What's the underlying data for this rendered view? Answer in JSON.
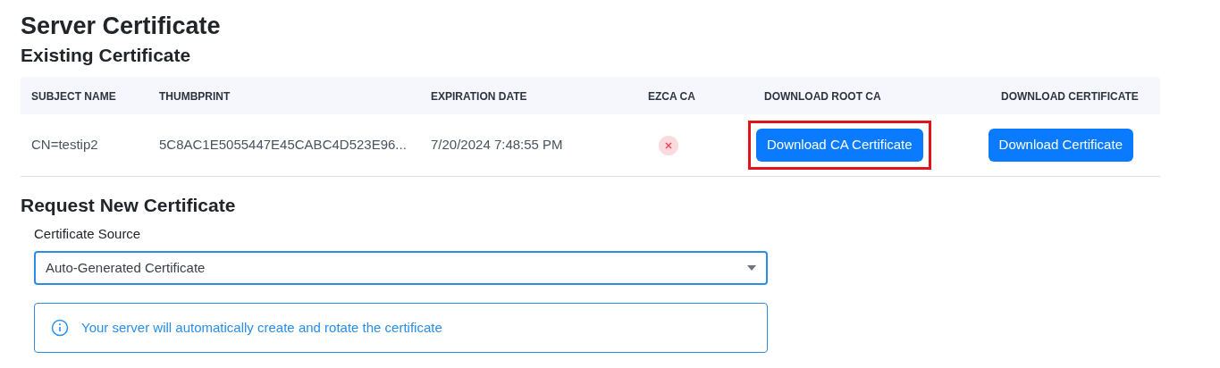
{
  "title": "Server Certificate",
  "existing": {
    "heading": "Existing Certificate",
    "columns": [
      "SUBJECT NAME",
      "THUMBPRINT",
      "EXPIRATION DATE",
      "EZCA CA",
      "DOWNLOAD ROOT CA",
      "DOWNLOAD CERTIFICATE"
    ],
    "rows": [
      {
        "subject": "CN=testip2",
        "thumbprint": "5C8AC1E5055447E45CABC4D523E96...",
        "expiration": "7/20/2024 7:48:55 PM",
        "ezca_ca": false,
        "root_button": {
          "label": "Download CA Certificate",
          "highlighted": true
        },
        "cert_button": {
          "label": "Download Certificate",
          "highlighted": false
        }
      }
    ]
  },
  "request": {
    "heading": "Request New Certificate",
    "source_label": "Certificate Source",
    "source_value": "Auto-Generated Certificate",
    "info": "Your server will automatically create and rotate the certificate"
  }
}
